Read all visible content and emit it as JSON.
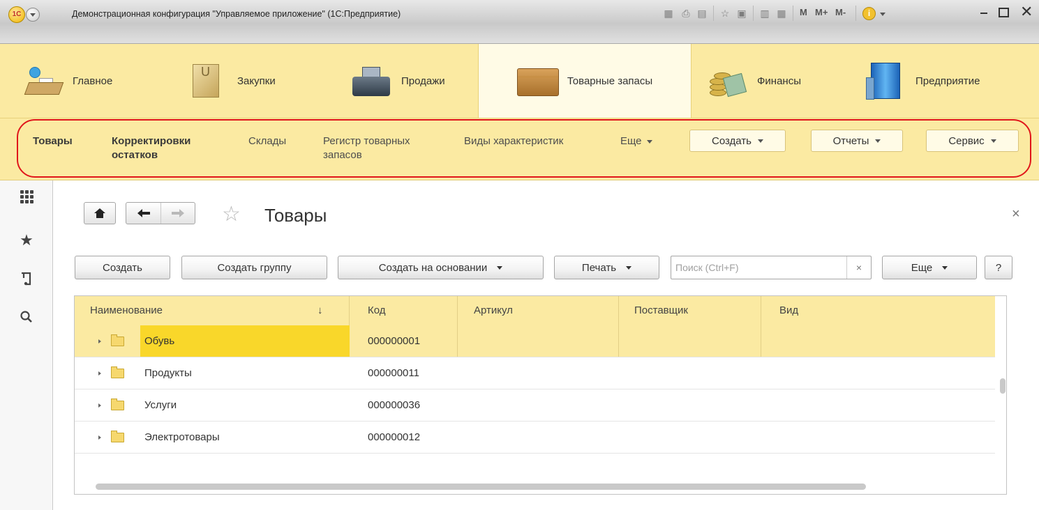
{
  "window": {
    "title": "Демонстрационная конфигурация \"Управляемое приложение\"  (1С:Предприятие)",
    "logo_text": "1С",
    "tb_m": "M",
    "tb_mplus": "M+",
    "tb_mminus": "M-",
    "tb_info": "i"
  },
  "sections": [
    {
      "label": "Главное",
      "icon": "desk-lamp-icon"
    },
    {
      "label": "Закупки",
      "icon": "shopping-bag-icon"
    },
    {
      "label": "Продажи",
      "icon": "cash-register-icon"
    },
    {
      "label": "Товарные запасы",
      "icon": "box-icon",
      "active": true
    },
    {
      "label": "Финансы",
      "icon": "coins-icon"
    },
    {
      "label": "Предприятие",
      "icon": "building-icon"
    }
  ],
  "nav": {
    "links": [
      {
        "line1": "Товары",
        "line2": "",
        "bold": true
      },
      {
        "line1": "Корректировки",
        "line2": "остатков",
        "bold": true
      },
      {
        "line1": "Склады",
        "line2": ""
      },
      {
        "line1": "Регистр товарных",
        "line2": "запасов"
      },
      {
        "line1": "Виды характеристик",
        "line2": ""
      }
    ],
    "more": "Еще",
    "buttons": {
      "create": "Создать",
      "reports": "Отчеты",
      "service": "Сервис"
    }
  },
  "form": {
    "title": "Товары",
    "close": "×",
    "toolbar": {
      "create": "Создать",
      "create_group": "Создать группу",
      "create_based": "Создать на основании",
      "print": "Печать",
      "search_placeholder": "Поиск (Ctrl+F)",
      "search_clear": "×",
      "more": "Еще",
      "help": "?"
    },
    "table": {
      "columns": [
        "Наименование",
        "Код",
        "Артикул",
        "Поставщик",
        "Вид"
      ],
      "sort_indicator": "↓",
      "rows": [
        {
          "name": "Обувь",
          "code": "000000001",
          "selected": true
        },
        {
          "name": "Продукты",
          "code": "000000011"
        },
        {
          "name": "Услуги",
          "code": "000000036"
        },
        {
          "name": "Электротовары",
          "code": "000000012"
        }
      ]
    }
  },
  "colors": {
    "panel": "#fbeaa2",
    "selection": "#f9d72a",
    "highlight_ring": "#e0161b"
  }
}
